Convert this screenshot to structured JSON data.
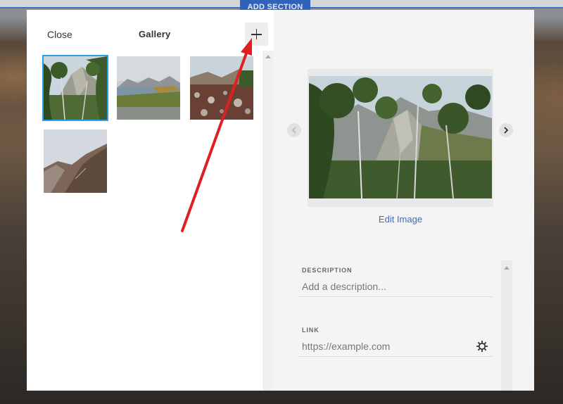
{
  "background": {
    "add_section_label": "ADD SECTION"
  },
  "gallery": {
    "close_label": "Close",
    "title": "Gallery",
    "add_icon": "plus-icon",
    "thumbnails": [
      {
        "alt": "mountain-trees",
        "selected": true
      },
      {
        "alt": "lake-mountains",
        "selected": false
      },
      {
        "alt": "rocky-field",
        "selected": false
      },
      {
        "alt": "mountain-slope",
        "selected": false
      }
    ]
  },
  "editor": {
    "edit_image_label": "Edit Image",
    "prev_icon": "chevron-left-icon",
    "next_icon": "chevron-right-icon",
    "description": {
      "label": "DESCRIPTION",
      "placeholder": "Add a description..."
    },
    "link": {
      "label": "LINK",
      "placeholder": "https://example.com",
      "settings_icon": "gear-icon"
    }
  },
  "colors": {
    "accent": "#3e6bc2",
    "selected_outline": "#2aa0e8",
    "annotation": "#e02020"
  }
}
